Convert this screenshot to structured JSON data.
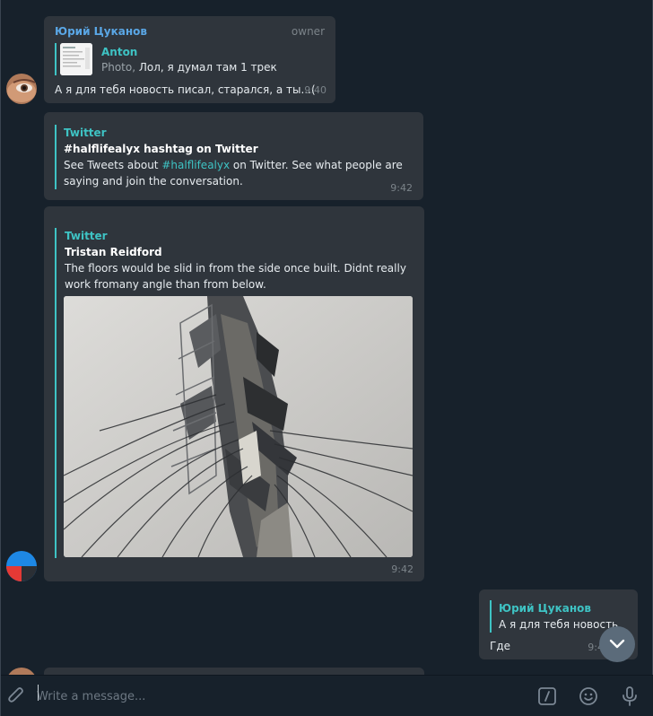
{
  "messages": {
    "m1": {
      "sender": "Юрий Цуканов",
      "badge": "owner",
      "reply_author": "Anton",
      "reply_prefix": "Photo,",
      "reply_text": "Лол, я думал там 1 трек",
      "text": "А я для тебя новость писал, старался, а ты...(",
      "time": "9:40"
    },
    "m2": {
      "preview_site": "Twitter",
      "preview_title": "#halflifealyx hashtag on Twitter",
      "preview_desc_prefix": "See Tweets about ",
      "preview_desc_hashtag": "#halflifealyx",
      "preview_desc_rest": " on Twitter. See what people are",
      "preview_desc_line2": "saying and join the conversation.",
      "time": "9:42"
    },
    "m3": {
      "preview_site": "Twitter",
      "preview_title": "Tristan Reidford",
      "preview_line1": "The floors would be slid in from the side once built. Didnt really",
      "preview_line2": "work fromany angle than from below.",
      "time": "9:42"
    },
    "m4": {
      "reply_author": "Юрий Цуканов",
      "reply_text": "А я для тебя новость",
      "text": "Где",
      "time": "9:4"
    }
  },
  "composer": {
    "placeholder": "Write a message..."
  },
  "colors": {
    "accent": "#3ec3c4",
    "sender": "#5aa7e6",
    "bubble": "#2f353c",
    "background": "#17212b"
  },
  "icons": [
    "attach-icon",
    "bot-commands-icon",
    "emoji-icon",
    "microphone-icon",
    "chevron-down-icon"
  ]
}
